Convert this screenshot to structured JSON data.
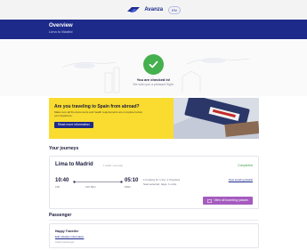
{
  "brand": {
    "logo_text": "Avanza",
    "language": "EN"
  },
  "header": {
    "title": "Overview",
    "subtitle": "Lima to Madrid"
  },
  "checkin": {
    "title": "You are checked in!",
    "subtitle": "We wish you a pleasant flight."
  },
  "banner": {
    "title": "Are you traveling to Spain from abroad?",
    "text": "Make sure all the documents and health requirements are complete before your departure.",
    "button_label": "Read more information"
  },
  "journeys": {
    "section_title": "Your journeys",
    "item": {
      "name": "Lima to Madrid",
      "meta": "1 adult, one-way",
      "status": "Completed",
      "dep_time": "10:40",
      "dep_station": "LIM",
      "duration": "12h 50m",
      "arr_time": "05:10",
      "arr_station": "MAD",
      "info_line1": "1 booking for 1 trip: 1 Checked",
      "info_line2": "Seat selected, bags, 1 extra",
      "link_label": "View booking details",
      "button_label": "View all boarding passes"
    }
  },
  "passenger": {
    "section_title": "Passenger",
    "name": "Happy Traveller",
    "link_label": "Edit traveller information",
    "meta": "Adult passenger"
  },
  "colors": {
    "header": "#1d2a8a",
    "banner": "#f9dc2f",
    "check": "#45b04e",
    "button": "#a55bbf"
  }
}
